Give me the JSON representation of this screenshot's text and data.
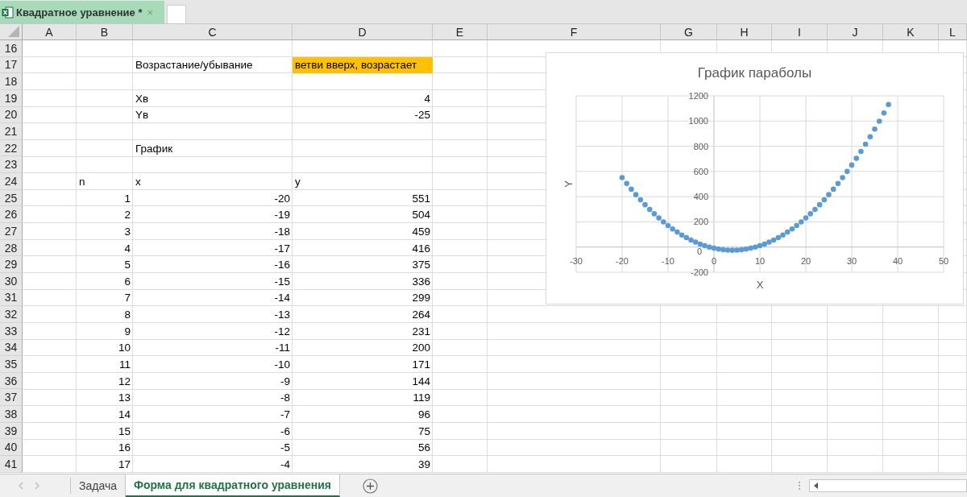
{
  "document_tab": {
    "title": "Квадратное уравнение *",
    "close": "×"
  },
  "columns": [
    "A",
    "B",
    "C",
    "D",
    "E",
    "F",
    "G",
    "H",
    "I",
    "J",
    "K",
    "L"
  ],
  "rows": [
    {
      "number": "16"
    },
    {
      "number": "17",
      "c": {
        "kind": "text",
        "text": "Возрастание/убывание"
      },
      "d": {
        "kind": "text",
        "text": "ветви вверх, возрастает",
        "highlighted": true
      }
    },
    {
      "number": "18"
    },
    {
      "number": "19",
      "c": {
        "kind": "text",
        "text": "Хв"
      },
      "d": {
        "kind": "number",
        "text": "4",
        "highlighted": false
      }
    },
    {
      "number": "20",
      "c": {
        "kind": "text",
        "text": "Yв"
      },
      "d": {
        "kind": "number",
        "text": "-25",
        "highlighted": false
      }
    },
    {
      "number": "21"
    },
    {
      "number": "22",
      "c": {
        "kind": "text",
        "text": "График"
      }
    },
    {
      "number": "23"
    },
    {
      "number": "24",
      "b": {
        "kind": "text",
        "text": "n"
      },
      "c": {
        "kind": "text",
        "text": "x"
      },
      "d": {
        "kind": "text",
        "text": "y",
        "highlighted": false
      }
    },
    {
      "number": "25",
      "b": {
        "kind": "number",
        "text": "1"
      },
      "c": {
        "kind": "number",
        "text": "-20"
      },
      "d": {
        "kind": "number",
        "text": "551",
        "highlighted": false
      }
    },
    {
      "number": "26",
      "b": {
        "kind": "number",
        "text": "2"
      },
      "c": {
        "kind": "number",
        "text": "-19"
      },
      "d": {
        "kind": "number",
        "text": "504",
        "highlighted": false
      }
    },
    {
      "number": "27",
      "b": {
        "kind": "number",
        "text": "3"
      },
      "c": {
        "kind": "number",
        "text": "-18"
      },
      "d": {
        "kind": "number",
        "text": "459",
        "highlighted": false
      }
    },
    {
      "number": "28",
      "b": {
        "kind": "number",
        "text": "4"
      },
      "c": {
        "kind": "number",
        "text": "-17"
      },
      "d": {
        "kind": "number",
        "text": "416",
        "highlighted": false
      }
    },
    {
      "number": "29",
      "b": {
        "kind": "number",
        "text": "5"
      },
      "c": {
        "kind": "number",
        "text": "-16"
      },
      "d": {
        "kind": "number",
        "text": "375",
        "highlighted": false
      }
    },
    {
      "number": "30",
      "b": {
        "kind": "number",
        "text": "6"
      },
      "c": {
        "kind": "number",
        "text": "-15"
      },
      "d": {
        "kind": "number",
        "text": "336",
        "highlighted": false
      }
    },
    {
      "number": "31",
      "b": {
        "kind": "number",
        "text": "7"
      },
      "c": {
        "kind": "number",
        "text": "-14"
      },
      "d": {
        "kind": "number",
        "text": "299",
        "highlighted": false
      }
    },
    {
      "number": "32",
      "b": {
        "kind": "number",
        "text": "8"
      },
      "c": {
        "kind": "number",
        "text": "-13"
      },
      "d": {
        "kind": "number",
        "text": "264",
        "highlighted": false
      }
    },
    {
      "number": "33",
      "b": {
        "kind": "number",
        "text": "9"
      },
      "c": {
        "kind": "number",
        "text": "-12"
      },
      "d": {
        "kind": "number",
        "text": "231",
        "highlighted": false
      }
    },
    {
      "number": "34",
      "b": {
        "kind": "number",
        "text": "10"
      },
      "c": {
        "kind": "number",
        "text": "-11"
      },
      "d": {
        "kind": "number",
        "text": "200",
        "highlighted": false
      }
    },
    {
      "number": "35",
      "b": {
        "kind": "number",
        "text": "11"
      },
      "c": {
        "kind": "number",
        "text": "-10"
      },
      "d": {
        "kind": "number",
        "text": "171",
        "highlighted": false
      }
    },
    {
      "number": "36",
      "b": {
        "kind": "number",
        "text": "12"
      },
      "c": {
        "kind": "number",
        "text": "-9"
      },
      "d": {
        "kind": "number",
        "text": "144",
        "highlighted": false
      }
    },
    {
      "number": "37",
      "b": {
        "kind": "number",
        "text": "13"
      },
      "c": {
        "kind": "number",
        "text": "-8"
      },
      "d": {
        "kind": "number",
        "text": "119",
        "highlighted": false
      }
    },
    {
      "number": "38",
      "b": {
        "kind": "number",
        "text": "14"
      },
      "c": {
        "kind": "number",
        "text": "-7"
      },
      "d": {
        "kind": "number",
        "text": "96",
        "highlighted": false
      }
    },
    {
      "number": "39",
      "b": {
        "kind": "number",
        "text": "15"
      },
      "c": {
        "kind": "number",
        "text": "-6"
      },
      "d": {
        "kind": "number",
        "text": "75",
        "highlighted": false
      }
    },
    {
      "number": "40",
      "b": {
        "kind": "number",
        "text": "16"
      },
      "c": {
        "kind": "number",
        "text": "-5"
      },
      "d": {
        "kind": "number",
        "text": "56",
        "highlighted": false
      }
    },
    {
      "number": "41",
      "b": {
        "kind": "number",
        "text": "17"
      },
      "c": {
        "kind": "number",
        "text": "-4"
      },
      "d": {
        "kind": "number",
        "text": "39",
        "highlighted": false
      }
    }
  ],
  "chart": {
    "chart_data": {
      "type": "scatter",
      "title": "График параболы",
      "xlabel": "X",
      "ylabel": "Y",
      "x": [
        -20,
        -19,
        -18,
        -17,
        -16,
        -15,
        -14,
        -13,
        -12,
        -11,
        -10,
        -9,
        -8,
        -7,
        -6,
        -5,
        -4,
        -3,
        -2,
        -1,
        0,
        1,
        2,
        3,
        4,
        5,
        6,
        7,
        8,
        9,
        10,
        11,
        12,
        13,
        14,
        15,
        16,
        17,
        18,
        19,
        20,
        21,
        22,
        23,
        24,
        25,
        26,
        27,
        28,
        29,
        30,
        31,
        32,
        33,
        34,
        35,
        36,
        37,
        38
      ],
      "series": [
        {
          "color": "#5b9bd5",
          "values": [
            551,
            504,
            459,
            416,
            375,
            336,
            299,
            264,
            231,
            200,
            171,
            144,
            119,
            96,
            75,
            56,
            39,
            24,
            11,
            0,
            -9,
            -16,
            -21,
            -24,
            -25,
            -24,
            -21,
            -16,
            -9,
            0,
            11,
            24,
            39,
            56,
            75,
            96,
            119,
            144,
            171,
            200,
            231,
            264,
            299,
            336,
            375,
            416,
            459,
            504,
            551,
            600,
            651,
            704,
            759,
            816,
            875,
            936,
            999,
            1064,
            1131
          ]
        }
      ],
      "xlim": [
        -30,
        50
      ],
      "ylim": [
        -200,
        1200
      ],
      "xticks": [
        -30,
        -20,
        -10,
        0,
        10,
        20,
        30,
        40,
        50
      ],
      "yticks": [
        -200,
        0,
        200,
        400,
        600,
        800,
        1000,
        1200
      ],
      "grid": true
    }
  },
  "sheet_tabs": [
    {
      "label": "Задача",
      "selected": false
    },
    {
      "label": "Форма для квадратного уравнения",
      "selected": true
    }
  ]
}
